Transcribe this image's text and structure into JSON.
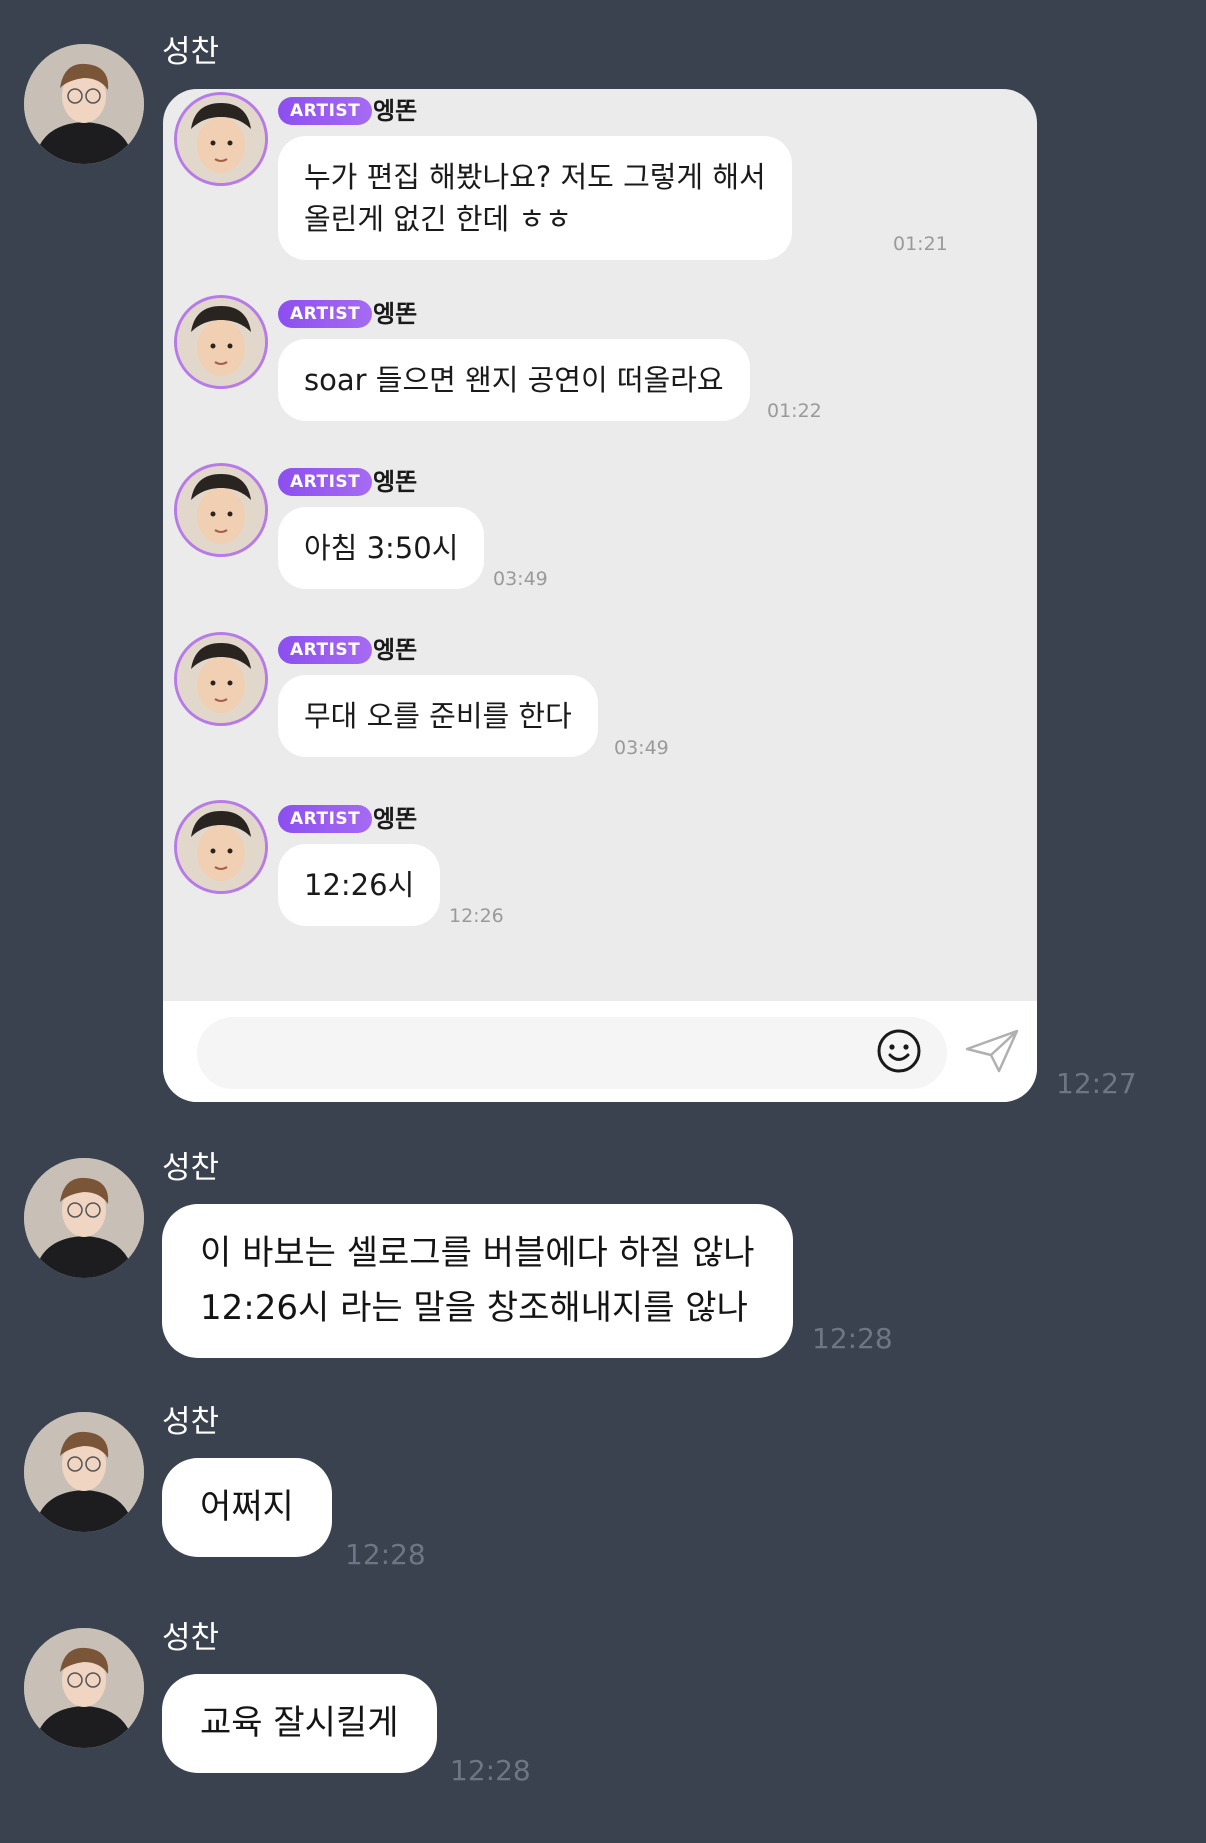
{
  "chat": {
    "sender_name": "성찬",
    "messages": [
      {
        "type": "image",
        "time": "12:27"
      },
      {
        "type": "text",
        "lines": [
          "이 바보는 셀로그를 버블에다 하질 않나",
          "12:26시 라는 말을 창조해내지를 않나"
        ],
        "time": "12:28"
      },
      {
        "type": "text",
        "lines": [
          "어쩌지"
        ],
        "time": "12:28"
      },
      {
        "type": "text",
        "lines": [
          "교육 잘시킬게"
        ],
        "time": "12:28"
      }
    ]
  },
  "embedded": {
    "badge": "ARTIST",
    "artist_name": "엥똔",
    "messages": [
      {
        "lines": [
          "누가 편집 해봤나요? 저도 그렇게 해서",
          "올린게 없긴 한데 ㅎㅎ"
        ],
        "time": "01:21"
      },
      {
        "lines": [
          "soar 들으면 왠지 공연이 떠올라요"
        ],
        "time": "01:22"
      },
      {
        "lines": [
          "아침 3:50시"
        ],
        "time": "03:49"
      },
      {
        "lines": [
          "무대 오를 준비를 한다"
        ],
        "time": "03:49"
      },
      {
        "lines": [
          "12:26시"
        ],
        "time": "12:26"
      }
    ],
    "icons": {
      "emoji": "smiley-icon",
      "send": "paper-plane-icon"
    }
  },
  "colors": {
    "background": "#3a4250",
    "bubble": "#ffffff",
    "badge": "#8c4ff0",
    "avatar_ring": "#b67be8"
  }
}
